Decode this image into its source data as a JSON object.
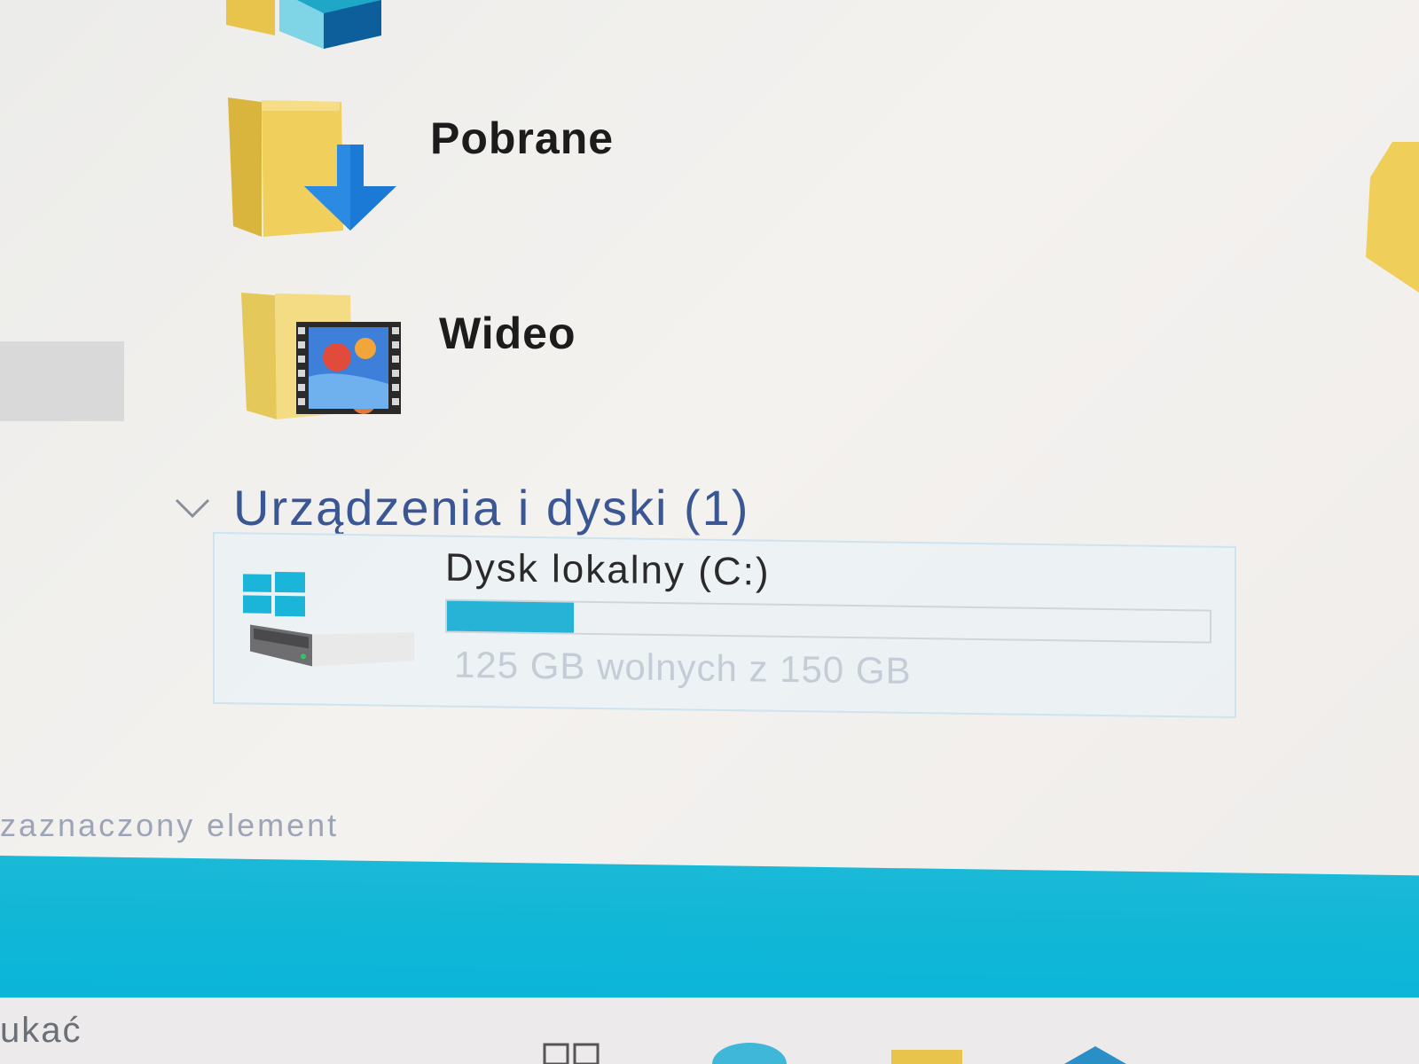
{
  "folders": [
    {
      "name": "Pobrane",
      "icon": "downloads-folder-icon"
    },
    {
      "name": "Wideo",
      "icon": "videos-folder-icon"
    }
  ],
  "devices_group": {
    "title": "Urządzenia i dyski (1)",
    "chevron_icon": "chevron-down-icon"
  },
  "drive": {
    "name": "Dysk lokalny (C:)",
    "free_text": "125 GB wolnych z 150 GB",
    "used_fraction": 0.1667,
    "bar_color": "#26b3d6",
    "icon": "windows-drive-icon"
  },
  "status_bar": {
    "text": "zaznaczony element"
  },
  "taskbar": {
    "accent_color": "#12b7d6",
    "search_text": "ukać"
  }
}
